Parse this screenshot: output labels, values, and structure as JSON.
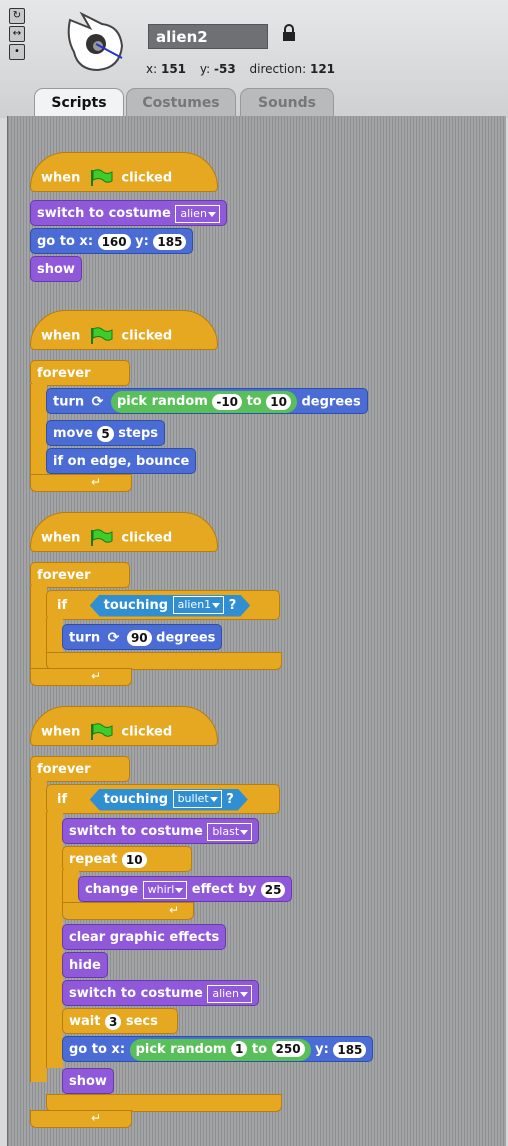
{
  "sprite": {
    "name": "alien2",
    "x_label": "x:",
    "x": "151",
    "y_label": "y:",
    "y": "-53",
    "dir_label": "direction:",
    "direction": "121"
  },
  "tabs": [
    "Scripts",
    "Costumes",
    "Sounds"
  ],
  "blocks": {
    "when": "when",
    "clicked": "clicked",
    "switch_costume": "switch to costume",
    "go_to_x": "go to x:",
    "y": "y:",
    "show": "show",
    "hide": "hide",
    "forever": "forever",
    "turn": "turn",
    "pick_random": "pick random",
    "to": "to",
    "degrees": "degrees",
    "move": "move",
    "steps": "steps",
    "if_edge": "if on edge, bounce",
    "if": "if",
    "touching": "touching",
    "question": "?",
    "repeat": "repeat",
    "change": "change",
    "effect_by": "effect by",
    "clear_effects": "clear graphic effects",
    "wait": "wait",
    "secs": "secs"
  },
  "values": {
    "costume_alien": "alien",
    "goto1_x": "160",
    "goto1_y": "185",
    "rand1_from": "-10",
    "rand1_to": "10",
    "move_steps": "5",
    "touch1": "alien1",
    "turn2": "90",
    "touch2": "bullet",
    "costume_blast": "blast",
    "repeat_n": "10",
    "effect": "whirl",
    "effect_by": "25",
    "wait_secs": "3",
    "rand2_from": "1",
    "rand2_to": "250",
    "goto2_y": "185"
  },
  "colors": {
    "events": "#e7a821",
    "looks": "#8f59d9",
    "motion": "#4a6cd4",
    "sensing": "#2f8fd2",
    "operators": "#59c059"
  }
}
